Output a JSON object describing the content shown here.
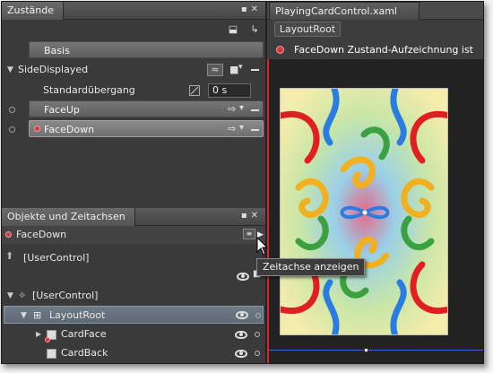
{
  "states_panel": {
    "title": "Zustände",
    "base_state": "Basis",
    "group_name": "SideDisplayed",
    "default_transition_label": "Standardübergang",
    "default_transition_value": "0 s",
    "states": [
      {
        "label": "FaceUp",
        "recording": false
      },
      {
        "label": "FaceDown",
        "recording": true
      }
    ]
  },
  "objects_panel": {
    "title": "Objekte und Zeitachsen",
    "storyboard": "FaceDown",
    "root_label": "[UserControl]",
    "tree": [
      {
        "label": "[UserControl]",
        "level": 0
      },
      {
        "label": "LayoutRoot",
        "level": 1,
        "selected": true
      },
      {
        "label": "CardFace",
        "level": 2
      },
      {
        "label": "CardBack",
        "level": 2
      }
    ],
    "tooltip": "Zeitachse anzeigen"
  },
  "document": {
    "tab": "PlayingCardControl.xaml",
    "breadcrumb": "LayoutRoot",
    "recording_banner": "FaceDown Zustand-Aufzeichnung ist an"
  },
  "colors": {
    "recording_red": "#d9363e",
    "selection_blue": "#5e6a76",
    "artboard_border": "#d8262e"
  }
}
